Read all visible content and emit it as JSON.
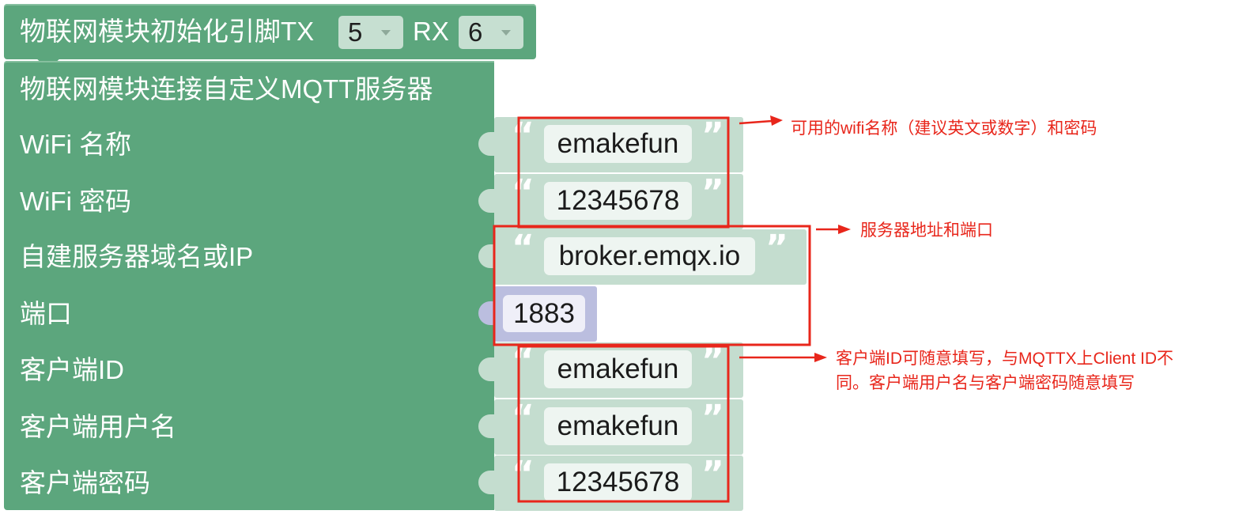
{
  "init_block": {
    "label": "物联网模块初始化引脚TX",
    "tx_value": "5",
    "rx_label": "RX",
    "rx_value": "6",
    "dropdown_icon": "dropdown-arrow-icon"
  },
  "connect_block": {
    "title": "物联网模块连接自定义MQTT服务器",
    "inputs": [
      {
        "label": "WiFi 名称",
        "value": "emakefun"
      },
      {
        "label": "WiFi 密码",
        "value": "12345678"
      },
      {
        "label": "自建服务器域名或IP",
        "value": "broker.emqx.io"
      },
      {
        "label": "端口",
        "value": "1883"
      },
      {
        "label": "客户端ID",
        "value": "emakefun"
      },
      {
        "label": "客户端用户名",
        "value": "emakefun"
      },
      {
        "label": "客户端密码",
        "value": "12345678"
      }
    ]
  },
  "quotes": {
    "open": "“",
    "close": "”"
  },
  "annotations": {
    "wifi_note": "可用的wifi名称（建议英文或数字）和密码",
    "server_note": "服务器地址和端口",
    "client_note": [
      "客户端ID可随意填写，与MQTTX上Client ID不",
      "同。客户端用户名与客户端密码随意填写"
    ]
  },
  "colors": {
    "block_green": "#5ca67d",
    "block_green_light": "#86bf9f",
    "block_green_dark": "#4f936c",
    "string_block": "#c4ddcf",
    "field_bg": "#eef5f1",
    "number_block": "#bbbedf",
    "number_field_bg": "#efeff8",
    "dropdown_bg": "#c6dfd1",
    "dropdown_arrow": "#8ea99a",
    "annotation_red": "#e8261b"
  }
}
